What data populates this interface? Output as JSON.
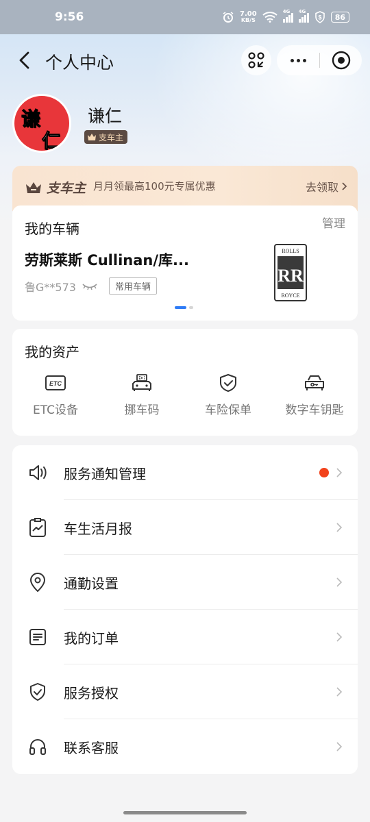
{
  "status_bar": {
    "time": "9:56",
    "speed_value": "7.00",
    "speed_unit": "KB/S",
    "net1": "4G",
    "net2": "4G",
    "battery": "86"
  },
  "navbar": {
    "title": "个人中心",
    "icons": [
      "back-icon",
      "scan-icon",
      "more-icon",
      "close-icon"
    ]
  },
  "profile": {
    "avatar_chars": [
      "谦",
      "仁"
    ],
    "name": "谦仁",
    "tag": "支车主"
  },
  "promo": {
    "brand": "支车主",
    "text": "月月领最高100元专属优惠",
    "cta": "去领取"
  },
  "vehicle": {
    "title": "我的车辆",
    "manage_label": "管理",
    "car_name": "劳斯莱斯 Cullinan/库...",
    "plate": "鲁G**573",
    "common_tag": "常用车辆",
    "logo_top": "ROLLS",
    "logo_mark": "RR",
    "logo_bottom": "ROYCE",
    "pager": {
      "total": 2,
      "active": 0
    }
  },
  "assets": {
    "title": "我的资产",
    "items": [
      {
        "label": "ETC设备",
        "icon": "etc-icon",
        "icon_text": "ETC"
      },
      {
        "label": "挪车码",
        "icon": "move-car-code-icon"
      },
      {
        "label": "车险保单",
        "icon": "insurance-shield-icon"
      },
      {
        "label": "数字车钥匙",
        "icon": "car-key-icon"
      }
    ]
  },
  "menu": {
    "items": [
      {
        "label": "服务通知管理",
        "icon": "speaker-icon",
        "badge": true
      },
      {
        "label": "车生活月报",
        "icon": "report-icon",
        "badge": false
      },
      {
        "label": "通勤设置",
        "icon": "location-pin-icon",
        "badge": false
      },
      {
        "label": "我的订单",
        "icon": "order-list-icon",
        "badge": false
      },
      {
        "label": "服务授权",
        "icon": "shield-check-icon",
        "badge": false
      },
      {
        "label": "联系客服",
        "icon": "headset-icon",
        "badge": false
      }
    ]
  },
  "colors": {
    "accent_blue": "#2f7cf6",
    "badge_red": "#f2421b",
    "avatar_red": "#e8363a",
    "tag_brown": "#5b4a42",
    "promo_bg": "#f9e4d1"
  }
}
